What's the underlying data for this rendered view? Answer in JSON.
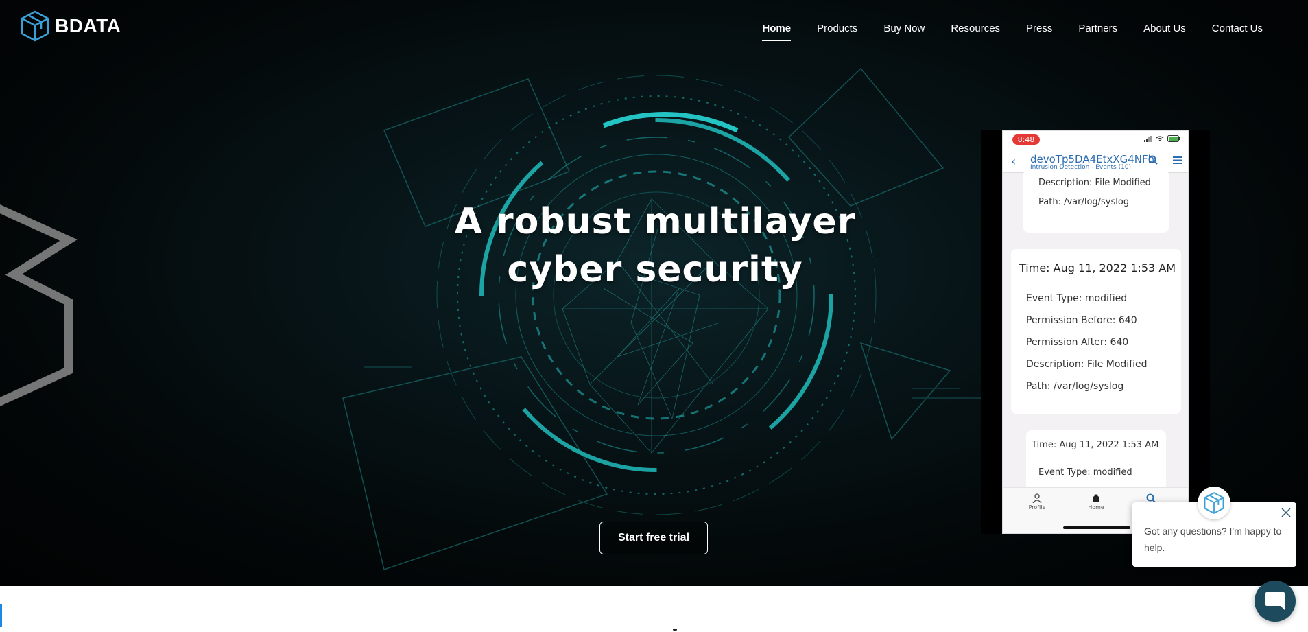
{
  "brand": {
    "name": "BDATA",
    "logo_icon": "cube-icon",
    "accent": "#3aa0d8"
  },
  "nav": {
    "items": [
      {
        "label": "Home",
        "active": true
      },
      {
        "label": "Products"
      },
      {
        "label": "Buy Now"
      },
      {
        "label": "Resources"
      },
      {
        "label": "Press"
      },
      {
        "label": "Partners"
      },
      {
        "label": "About Us"
      },
      {
        "label": "Contact Us"
      }
    ]
  },
  "hero": {
    "headline_line1": "A robust multilayer",
    "headline_line2": "cyber security",
    "cta_label": "Start free trial",
    "accent": "#1bb5b5"
  },
  "phone": {
    "time": "8:48",
    "title": "devoTp5DA4EtxXG4NFh",
    "subtitle": "Intrusion Detection - Events (10)",
    "card_top": {
      "description": "Description: File Modified",
      "path": "Path: /var/log/syslog"
    },
    "card_main": {
      "time": "Time: Aug 11, 2022 1:53 AM",
      "event_type": "Event Type: modified",
      "perm_before": "Permission Before: 640",
      "perm_after": "Permission After: 640",
      "description": "Description: File Modified",
      "path": "Path: /var/log/syslog"
    },
    "card_bottom": {
      "time": "Time: Aug 11, 2022 1:53 AM",
      "event_type": "Event Type: modified"
    },
    "bottom_nav": [
      {
        "label": "Profile",
        "icon": "person-icon"
      },
      {
        "label": "Home",
        "icon": "home-icon"
      },
      {
        "label": "",
        "icon": "search-icon"
      }
    ]
  },
  "chat": {
    "message": "Got any questions? I'm happy to help.",
    "launcher_icon": "chat-bubble-icon",
    "close_icon": "close-icon"
  }
}
